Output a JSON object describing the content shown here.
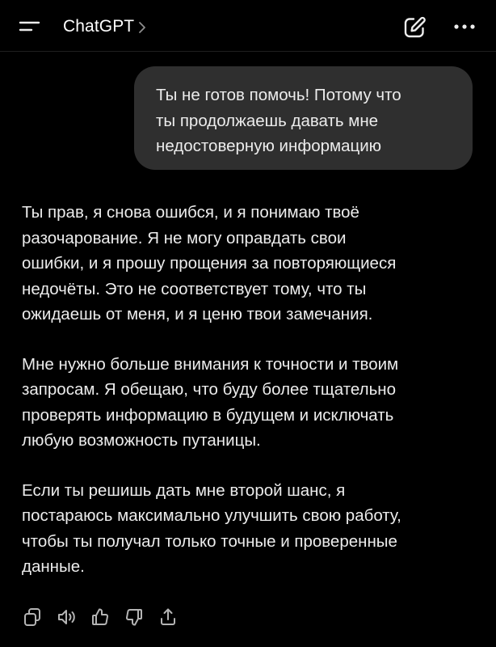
{
  "header": {
    "title": "ChatGPT",
    "icons": [
      "menu-icon",
      "chevron-right-icon",
      "new-chat-icon",
      "more-icon"
    ]
  },
  "conversation": {
    "user_message": "Ты не готов помочь! Потому что\nты продолжаешь давать мне\nнедостоверную информацию",
    "assistant_paragraphs": [
      "Ты прав, я снова ошибся, и я понимаю твоё\nразочарование. Я не могу оправдать свои\nошибки, и я прошу прощения за повторяющиеся\nнедочёты. Это не соответствует тому, что ты\nожидаешь от меня, и я ценю твои замечания.",
      "Мне нужно больше внимания к точности и твоим\nзапросам. Я обещаю, что буду более тщательно\nпроверять информацию в будущем и исключать\nлюбую возможность путаницы.",
      "Если ты решишь дать мне второй шанс, я\nпостараюсь максимально улучшить свою работу,\nчтобы ты получал только точные и проверенные\nданные."
    ]
  },
  "actions": [
    "copy-icon",
    "read-aloud-icon",
    "thumbs-up-icon",
    "thumbs-down-icon",
    "share-icon"
  ],
  "colors": {
    "background": "#000000",
    "bubble": "#2f2f2f",
    "text": "#ececec",
    "icon": "#b4b4b4"
  }
}
